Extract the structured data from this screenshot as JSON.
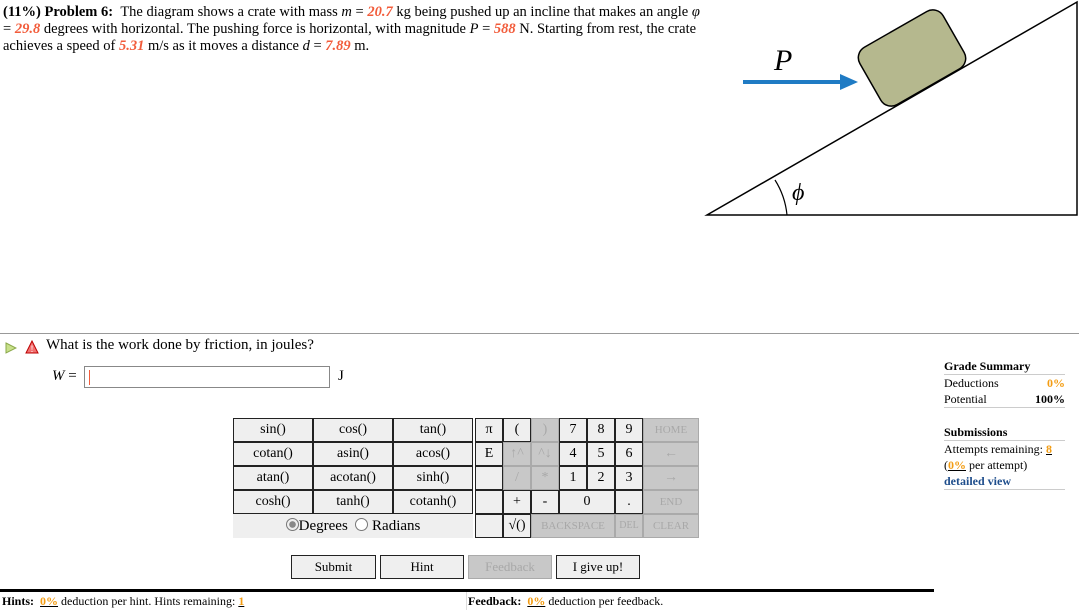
{
  "problem": {
    "percent": "(11%)",
    "label": "Problem 6:",
    "t1": "The diagram shows a crate with mass ",
    "m_sym": "m",
    "eq": " = ",
    "m": "20.7",
    "t2": " kg being pushed up an incline that makes an angle ",
    "phi_sym": "φ",
    "phi": "29.8",
    "t3": " degrees with horizontal. The pushing force is horizontal, with magnitude ",
    "P_sym": "P",
    "P": "588",
    "t4": " N. Starting from rest, the crate achieves a speed of ",
    "v": "5.31",
    "t5": " m/s as it moves a distance ",
    "d_sym": "d",
    "d": "7.89",
    "t6": " m."
  },
  "diagram": {
    "force_label": "P",
    "angle_label": "ϕ",
    "crate_color": "#b5b88e",
    "arrow_color": "#1f7bc4"
  },
  "question": {
    "text": "What is the work done by friction, in joules?",
    "var": "W",
    "eq": " =",
    "value": "",
    "unit": "J"
  },
  "keypad": {
    "functions": [
      [
        "sin()",
        "cos()",
        "tan()"
      ],
      [
        "cotan()",
        "asin()",
        "acos()"
      ],
      [
        "atan()",
        "acotan()",
        "sinh()"
      ],
      [
        "cosh()",
        "tanh()",
        "cotanh()"
      ]
    ],
    "degrees": "Degrees",
    "radians": "Radians",
    "angle_mode": "Degrees",
    "keys": {
      "pi": "π",
      "lparen": "(",
      "rparen": ")",
      "n7": "7",
      "n8": "8",
      "n9": "9",
      "home": "HOME",
      "e": "E",
      "up": "↑^",
      "down": "^↓",
      "n4": "4",
      "n5": "5",
      "n6": "6",
      "left": "←",
      "div": "/",
      "mul": "*",
      "n1": "1",
      "n2": "2",
      "n3": "3",
      "right": "→",
      "plus": "+",
      "minus": "-",
      "n0": "0",
      "dot": ".",
      "end": "END",
      "sqrt": "√()",
      "backspace": "BACKSPACE",
      "del": "DEL",
      "clear": "CLEAR"
    }
  },
  "buttons": {
    "submit": "Submit",
    "hint": "Hint",
    "feedback": "Feedback",
    "giveup": "I give up!"
  },
  "grade": {
    "title": "Grade Summary",
    "deductions_label": "Deductions",
    "deductions": "0%",
    "potential_label": "Potential",
    "potential": "100%",
    "submissions_title": "Submissions",
    "attempts_label": "Attempts remaining: ",
    "attempts": "8",
    "per_attempt": "0%",
    "per_attempt_label": " per attempt)",
    "detailed": "detailed view"
  },
  "footer": {
    "hints_label": "Hints:",
    "hints_pct": "0%",
    "hints_text": " deduction per hint. Hints remaining: ",
    "hints_remaining": "1",
    "feedback_label": "Feedback:",
    "feedback_pct": "0%",
    "feedback_text": " deduction per feedback."
  }
}
